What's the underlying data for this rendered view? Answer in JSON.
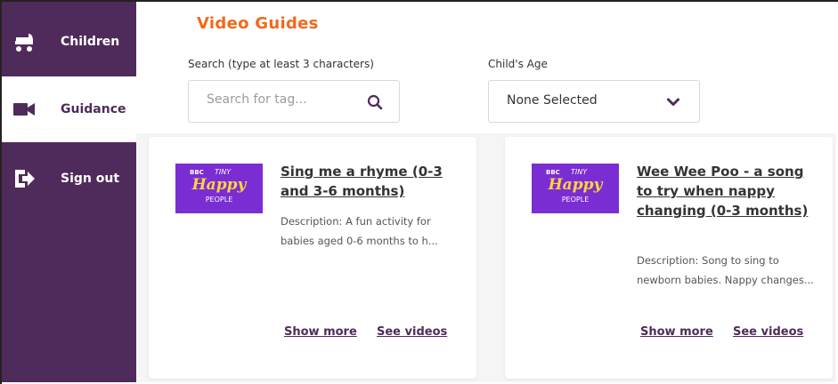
{
  "sidebar": {
    "items": [
      {
        "label": "Children",
        "icon": "pram-icon"
      },
      {
        "label": "Guidance",
        "icon": "video-camera-icon",
        "active": true
      },
      {
        "label": "Sign out",
        "icon": "sign-out-icon"
      }
    ]
  },
  "header": {
    "title": "Video Guides"
  },
  "search": {
    "label": "Search (type at least 3 characters)",
    "placeholder": "Search for tag...",
    "value": ""
  },
  "age_filter": {
    "label": "Child's Age",
    "selected": "None Selected"
  },
  "cards": [
    {
      "thumbnail": {
        "bbc": "BBC",
        "tiny": "TINY",
        "happy": "Happy",
        "people": "PEOPLE"
      },
      "title": "Sing me a rhyme (0-3 and 3-6 months)",
      "description": "Description: A fun activity for babies aged 0-6 months to h...",
      "show_more": "Show more",
      "see_videos": "See videos"
    },
    {
      "thumbnail": {
        "bbc": "BBC",
        "tiny": "TINY",
        "happy": "Happy",
        "people": "PEOPLE"
      },
      "title": "Wee Wee Poo - a song to try when nappy changing (0-3 months)",
      "description": "Description: Song to sing to newborn babies. Nappy changes...",
      "show_more": "Show more",
      "see_videos": "See videos"
    }
  ],
  "colors": {
    "sidebar": "#4f2b5b",
    "accent": "#f06a1c",
    "thumbnail": "#7b2dd4",
    "thumbnail_text": "#ffd43a"
  }
}
